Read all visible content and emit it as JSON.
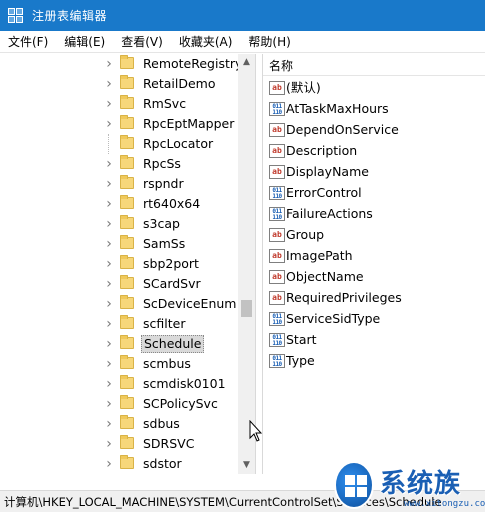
{
  "window": {
    "title": "注册表编辑器"
  },
  "menu": [
    "文件(F)",
    "编辑(E)",
    "查看(V)",
    "收藏夹(A)",
    "帮助(H)"
  ],
  "tree": {
    "items": [
      {
        "label": "RemoteRegistry",
        "expandable": true
      },
      {
        "label": "RetailDemo",
        "expandable": true
      },
      {
        "label": "RmSvc",
        "expandable": true
      },
      {
        "label": "RpcEptMapper",
        "expandable": true
      },
      {
        "label": "RpcLocator",
        "expandable": false
      },
      {
        "label": "RpcSs",
        "expandable": true
      },
      {
        "label": "rspndr",
        "expandable": true
      },
      {
        "label": "rt640x64",
        "expandable": true
      },
      {
        "label": "s3cap",
        "expandable": true
      },
      {
        "label": "SamSs",
        "expandable": true
      },
      {
        "label": "sbp2port",
        "expandable": true
      },
      {
        "label": "SCardSvr",
        "expandable": true
      },
      {
        "label": "ScDeviceEnum",
        "expandable": true
      },
      {
        "label": "scfilter",
        "expandable": true
      },
      {
        "label": "Schedule",
        "expandable": true,
        "selected": true
      },
      {
        "label": "scmbus",
        "expandable": true
      },
      {
        "label": "scmdisk0101",
        "expandable": true
      },
      {
        "label": "SCPolicySvc",
        "expandable": true
      },
      {
        "label": "sdbus",
        "expandable": true
      },
      {
        "label": "SDRSVC",
        "expandable": true
      },
      {
        "label": "sdstor",
        "expandable": true
      }
    ]
  },
  "values_list": {
    "column_name": "名称",
    "items": [
      {
        "name": "(默认)",
        "type": "sz"
      },
      {
        "name": "AtTaskMaxHours",
        "type": "bin"
      },
      {
        "name": "DependOnService",
        "type": "sz"
      },
      {
        "name": "Description",
        "type": "sz"
      },
      {
        "name": "DisplayName",
        "type": "sz"
      },
      {
        "name": "ErrorControl",
        "type": "bin"
      },
      {
        "name": "FailureActions",
        "type": "bin"
      },
      {
        "name": "Group",
        "type": "sz"
      },
      {
        "name": "ImagePath",
        "type": "sz"
      },
      {
        "name": "ObjectName",
        "type": "sz"
      },
      {
        "name": "RequiredPrivileges",
        "type": "sz"
      },
      {
        "name": "ServiceSidType",
        "type": "bin"
      },
      {
        "name": "Start",
        "type": "bin"
      },
      {
        "name": "Type",
        "type": "bin"
      }
    ]
  },
  "icons": {
    "sz": "ab",
    "bin": "011\n110"
  },
  "status": {
    "path": "计算机\\HKEY_LOCAL_MACHINE\\SYSTEM\\CurrentControlSet\\Services\\Schedule"
  },
  "watermark": {
    "text": "系统族",
    "url": "www.xitongzu.com"
  },
  "colors": {
    "titlebar": "#1979ca",
    "folder": "#f7d77a",
    "selection": "#d9d9d9"
  }
}
